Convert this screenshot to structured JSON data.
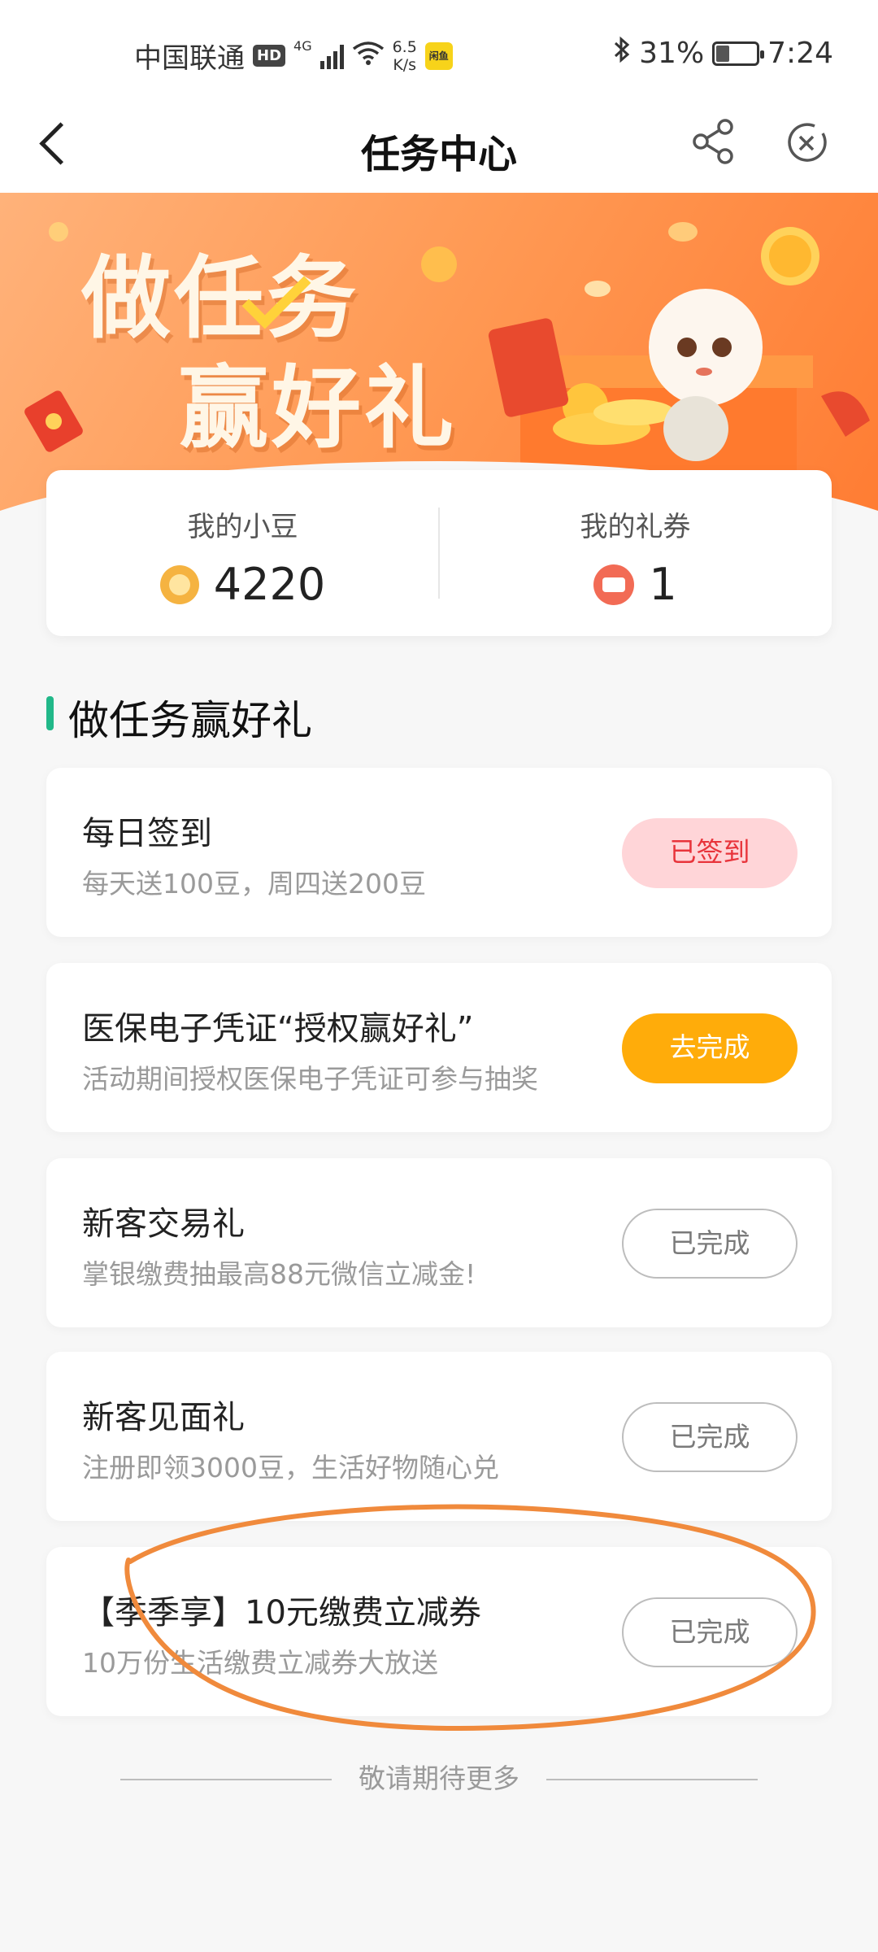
{
  "status_bar": {
    "carrier": "中国联通",
    "hd": "HD",
    "net": "4G",
    "speed_value": "6.5",
    "speed_unit": "K/s",
    "app_badge": "闲鱼",
    "battery": "31%",
    "battery_level": 0.31,
    "time": "7:24"
  },
  "header": {
    "title": "任务中心"
  },
  "banner": {
    "line1": "做任务",
    "line2": "赢好礼"
  },
  "stats": {
    "beans_label": "我的小豆",
    "beans_value": "4220",
    "coupons_label": "我的礼券",
    "coupons_value": "1"
  },
  "section": {
    "title": "做任务赢好礼"
  },
  "tasks": [
    {
      "title": "每日签到",
      "desc": "每天送100豆，周四送200豆",
      "button": "已签到"
    },
    {
      "title": "医保电子凭证“授权赢好礼”",
      "desc": "活动期间授权医保电子凭证可参与抽奖",
      "button": "去完成"
    },
    {
      "title": "新客交易礼",
      "desc": "掌银缴费抽最高88元微信立减金!",
      "button": "已完成"
    },
    {
      "title": "新客见面礼",
      "desc": "注册即领3000豆，生活好物随心兑",
      "button": "已完成"
    },
    {
      "title": "【季季享】10元缴费立减券",
      "desc": "10万份生活缴费立减券大放送",
      "button": "已完成"
    }
  ],
  "footer": {
    "text": "敬请期待更多"
  },
  "colors": {
    "accent_green": "#21b889",
    "banner_orange": "#ff8a3d",
    "go_button": "#ffac0a",
    "signed_button_bg": "#ffd5d8",
    "signed_button_text": "#e8343b",
    "annotation_stroke": "#f08a3c"
  }
}
